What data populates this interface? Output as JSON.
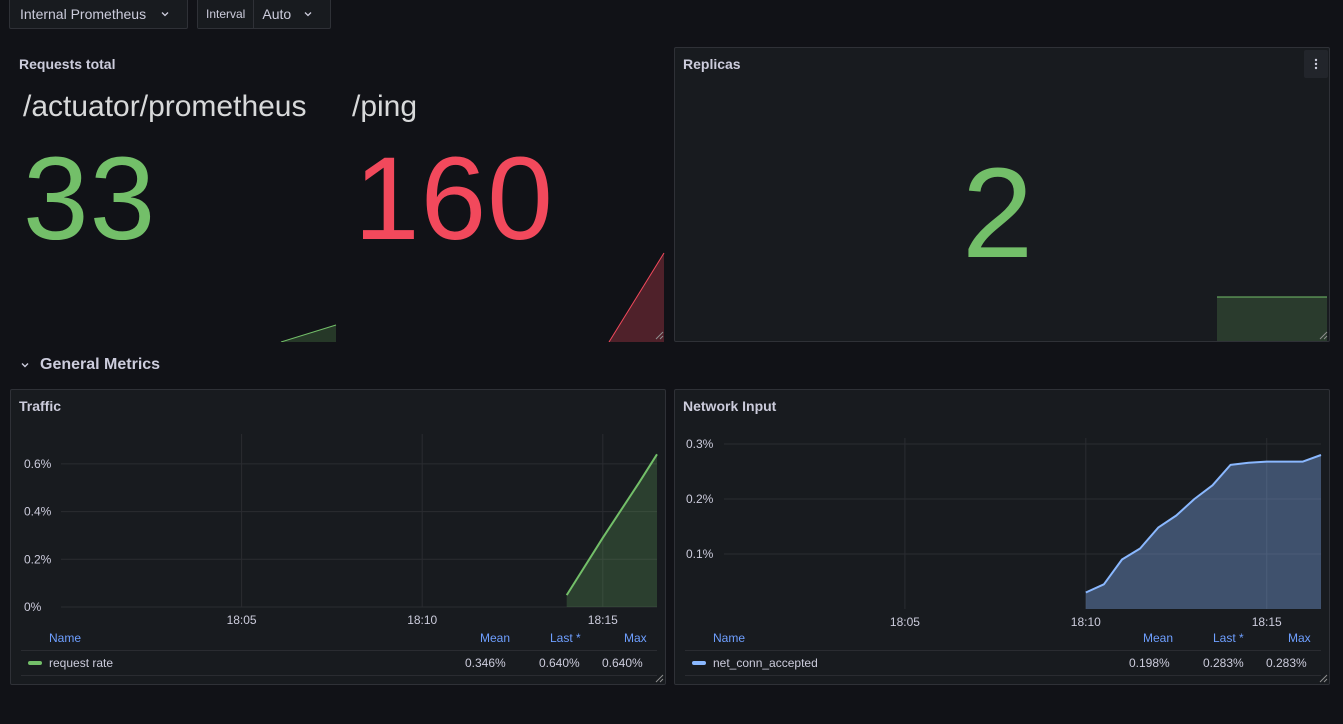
{
  "toolbar": {
    "datasource": "Internal Prometheus",
    "interval_label": "Interval",
    "interval_value": "Auto"
  },
  "requests_panel": {
    "title": "Requests total",
    "stats": [
      {
        "label": "/actuator/prometheus",
        "value": "33",
        "color": "#73bf69"
      },
      {
        "label": "/ping",
        "value": "160",
        "color": "#f2495c"
      }
    ]
  },
  "replicas_panel": {
    "title": "Replicas",
    "value": "2",
    "color": "#73bf69"
  },
  "row": {
    "title": "General Metrics"
  },
  "traffic_panel": {
    "title": "Traffic",
    "legend_headers": {
      "name": "Name",
      "mean": "Mean",
      "last": "Last *",
      "max": "Max"
    },
    "legend_rows": [
      {
        "name": "request rate",
        "mean": "0.346%",
        "last": "0.640%",
        "max": "0.640%",
        "color": "#73bf69"
      }
    ]
  },
  "network_panel": {
    "title": "Network Input",
    "legend_headers": {
      "name": "Name",
      "mean": "Mean",
      "last": "Last *",
      "max": "Max"
    },
    "legend_rows": [
      {
        "name": "net_conn_accepted",
        "mean": "0.198%",
        "last": "0.283%",
        "max": "0.283%",
        "color": "#8ab8ff"
      }
    ]
  },
  "chart_data": [
    {
      "type": "line",
      "title": "Traffic",
      "x_ticks": [
        "18:05",
        "18:10",
        "18:15"
      ],
      "y_ticks": [
        "0%",
        "0.2%",
        "0.4%",
        "0.6%"
      ],
      "ylim": [
        0,
        0.7
      ],
      "series": [
        {
          "name": "request rate",
          "color": "#73bf69",
          "x": [
            "18:14",
            "18:15",
            "18:16",
            "18:16:30"
          ],
          "values": [
            0.05,
            0.29,
            0.52,
            0.64
          ]
        }
      ]
    },
    {
      "type": "area",
      "title": "Network Input",
      "x_ticks": [
        "18:05",
        "18:10",
        "18:15"
      ],
      "y_ticks": [
        "0.1%",
        "0.2%",
        "0.3%"
      ],
      "ylim": [
        0,
        0.3
      ],
      "series": [
        {
          "name": "net_conn_accepted",
          "color": "#8ab8ff",
          "x": [
            "18:10",
            "18:10:30",
            "18:11",
            "18:11:30",
            "18:12",
            "18:12:30",
            "18:13",
            "18:13:30",
            "18:14",
            "18:14:30",
            "18:15",
            "18:15:30",
            "18:16",
            "18:16:30"
          ],
          "values": [
            0.03,
            0.045,
            0.09,
            0.11,
            0.148,
            0.17,
            0.2,
            0.225,
            0.262,
            0.266,
            0.268,
            0.268,
            0.268,
            0.28
          ]
        }
      ]
    }
  ]
}
